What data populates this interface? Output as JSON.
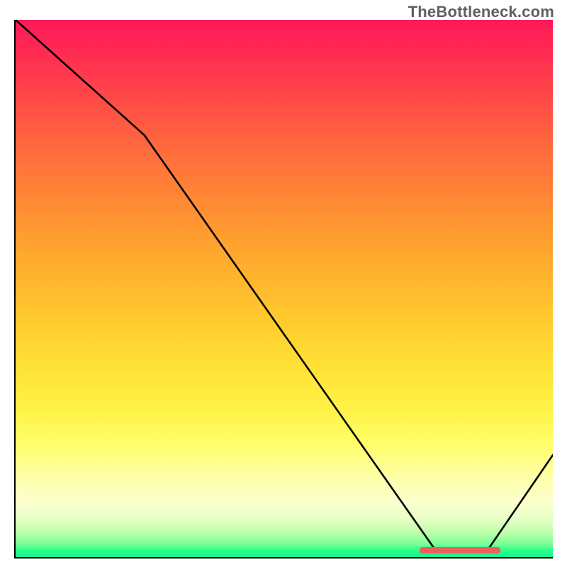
{
  "attribution": "TheBottleneck.com",
  "chart_data": {
    "type": "line",
    "title": "",
    "xlabel": "",
    "ylabel": "",
    "xlim": [
      0,
      100
    ],
    "ylim": [
      0,
      100
    ],
    "x": [
      0,
      24,
      78,
      88,
      100
    ],
    "values": [
      100,
      78.5,
      1.5,
      1.5,
      19
    ],
    "optimal_band": {
      "x_start": 75,
      "x_end": 90,
      "y": 1.5
    },
    "background": "vertical gradient red→orange→yellow→pale→green",
    "legend": null,
    "grid": false
  }
}
